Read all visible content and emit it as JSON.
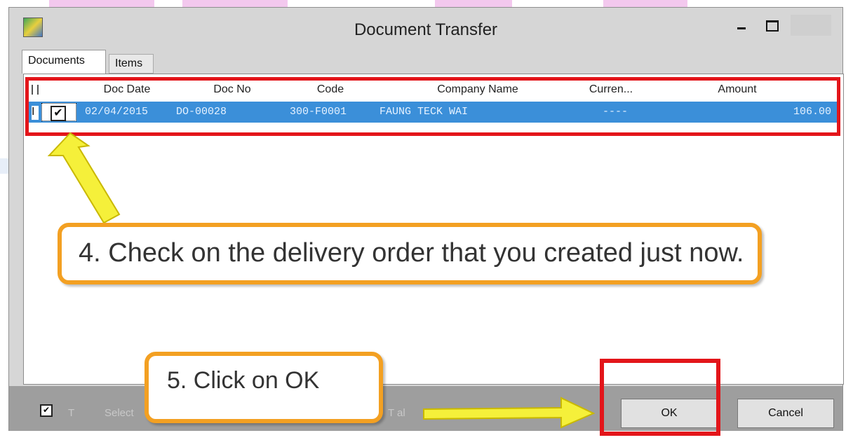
{
  "window": {
    "title": "Document Transfer"
  },
  "tabs": [
    {
      "label": "Documents"
    },
    {
      "label": "Items"
    }
  ],
  "grid": {
    "columns": [
      "Doc Date",
      "Doc No",
      "Code",
      "Company Name",
      "Curren...",
      "Amount"
    ],
    "rows": [
      {
        "checked": true,
        "check_mark": "✔",
        "row_indicator": "I",
        "doc_date": "02/04/2015",
        "doc_no": "DO-00028",
        "code": "300-F0001",
        "company_name": "FAUNG TECK WAI",
        "currency": "----",
        "amount": "106.00"
      }
    ]
  },
  "bottom_bar": {
    "select_all_checked": true,
    "select_all_mark": "✔",
    "faint_label_1": "T",
    "faint_label_2": "Select",
    "faint_label_3": "T al",
    "ok_label": "OK",
    "cancel_label": "Cancel"
  },
  "annotations": {
    "callout_4": "4. Check on the delivery order that you created just now.",
    "callout_5": "5. Click on OK"
  },
  "colors": {
    "highlight_red": "#e3151a",
    "callout_border": "#f3a022",
    "arrow_yellow": "#f5f03a",
    "selected_row": "#3b8fd9"
  }
}
